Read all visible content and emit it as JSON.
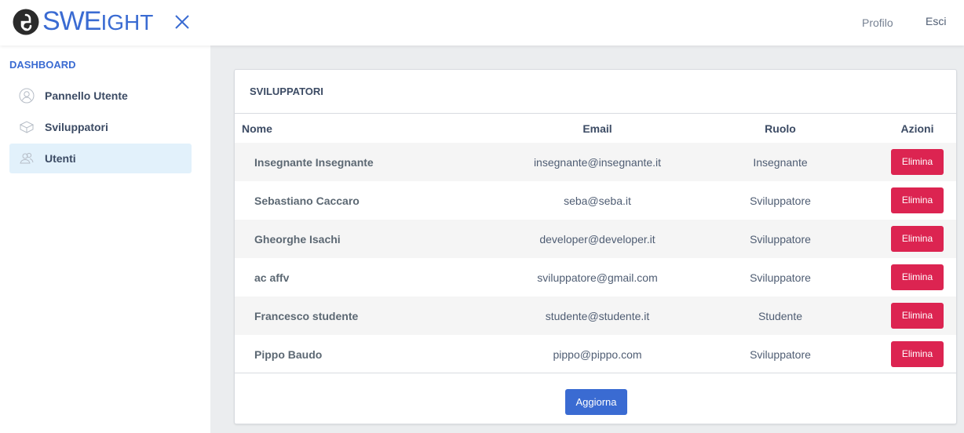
{
  "header": {
    "brand_big": "SWE",
    "brand_small": "IGHT",
    "profile_link": "Profilo",
    "logout_link": "Esci"
  },
  "sidebar": {
    "title": "DASHBOARD",
    "items": [
      {
        "label": "Pannello Utente",
        "icon": "user-icon",
        "active": false
      },
      {
        "label": "Sviluppatori",
        "icon": "box-icon",
        "active": false
      },
      {
        "label": "Utenti",
        "icon": "users-icon",
        "active": true
      }
    ]
  },
  "card": {
    "title": "SVILUPPATORI",
    "columns": [
      "Nome",
      "Email",
      "Ruolo",
      "Azioni"
    ],
    "rows": [
      {
        "name": "Insegnante Insegnante",
        "email": "insegnante@insegnante.it",
        "role": "Insegnante",
        "action": "Elimina"
      },
      {
        "name": "Sebastiano Caccaro",
        "email": "seba@seba.it",
        "role": "Sviluppatore",
        "action": "Elimina"
      },
      {
        "name": "Gheorghe Isachi",
        "email": "developer@developer.it",
        "role": "Sviluppatore",
        "action": "Elimina"
      },
      {
        "name": "ac affv",
        "email": "sviluppatore@gmail.com",
        "role": "Sviluppatore",
        "action": "Elimina"
      },
      {
        "name": "Francesco studente",
        "email": "studente@studente.it",
        "role": "Studente",
        "action": "Elimina"
      },
      {
        "name": "Pippo Baudo",
        "email": "pippo@pippo.com",
        "role": "Sviluppatore",
        "action": "Elimina"
      }
    ],
    "refresh_button": "Aggiorna"
  },
  "colors": {
    "primary": "#3a6bd2",
    "danger": "#dc2451",
    "active_nav_bg": "#e2f1fb"
  }
}
